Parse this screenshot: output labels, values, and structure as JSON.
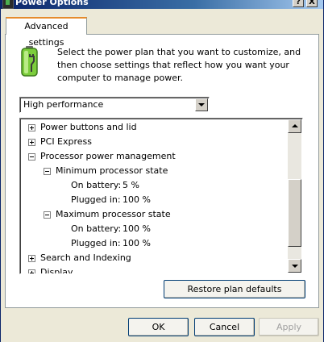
{
  "window": {
    "title": "Power Options",
    "help_btn": "?",
    "close_btn": "X"
  },
  "tabs": [
    {
      "label": "Advanced settings"
    }
  ],
  "description": "Select the power plan that you want to customize, and then choose settings that reflect how you want your computer to manage power.",
  "plan_select": {
    "value": "High performance"
  },
  "tree": {
    "rows": [
      {
        "label": "Power buttons and lid",
        "expander": "+"
      },
      {
        "label": "PCI Express",
        "expander": "+"
      },
      {
        "label": "Processor power management",
        "expander": "-"
      },
      {
        "label": "Minimum processor state",
        "expander": "-"
      },
      {
        "label": "On battery:",
        "value": "5 %"
      },
      {
        "label": "Plugged in:",
        "value": "100 %"
      },
      {
        "label": "Maximum processor state",
        "expander": "-"
      },
      {
        "label": "On battery:",
        "value": "100 %"
      },
      {
        "label": "Plugged in:",
        "value": "100 %"
      },
      {
        "label": "Search and Indexing",
        "expander": "+"
      },
      {
        "label": "Display",
        "expander": "+"
      }
    ]
  },
  "buttons": {
    "restore": "Restore plan defaults",
    "ok": "OK",
    "cancel": "Cancel",
    "apply": "Apply"
  },
  "colors": {
    "dialog_bg": "#ece9d8",
    "title_bar": "#0a246a",
    "tab_highlight": "#e68b2c",
    "disabled_text": "#a0a0a0"
  },
  "icons": {
    "title": "power-options-icon",
    "battery": "battery-plug-icon"
  }
}
